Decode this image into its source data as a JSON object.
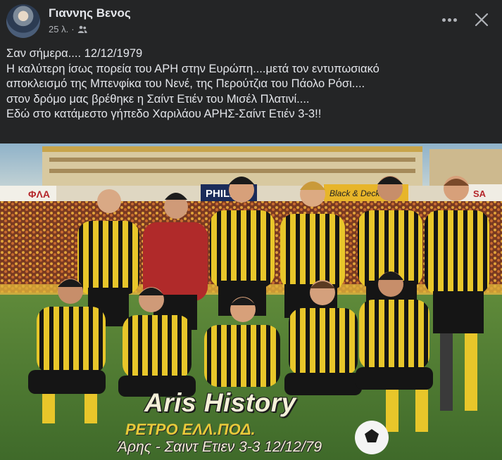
{
  "post": {
    "author": "Γιαννης Βενος",
    "time": "25 λ.",
    "separator": "·",
    "audience_icon": "friends-icon",
    "more_icon": "more-options-icon",
    "close_icon": "close-icon",
    "text_lines": [
      "Σαν σήμερα.... 12/12/1979",
      "Η καλύτερη ίσως πορεία του ΑΡΗ στην Ευρώπη....μετά τον εντυπωσιακό",
      "αποκλεισμό της Μπενφίκα του Νενέ, της Περούτζια του Πάολο Ρόσι....",
      "στον δρόμο μας βρέθηκε η Σαίντ Ετιέν του Μισέλ Πλατινί....",
      "Εδώ στο κατάμεστο γήπεδο Χαριλάου ΑΡΗΣ-Σαίντ Ετιέν 3-3!!"
    ]
  },
  "photo": {
    "stadium_banners": [
      "ΦΛΑ",
      "PHILIPS",
      "Black & Decker",
      "SA"
    ],
    "watermark_title": "Aris History",
    "watermark_subtitle": "ΡΕΤΡΟ ΕΛΛ.ΠΟΔ.",
    "watermark_caption": "Άρης - Σαιντ Ετιεν 3-3  12/12/79"
  },
  "colors": {
    "background": "#242526",
    "text": "#e4e6eb",
    "secondary_text": "#b0b3b8",
    "kit_yellow": "#e8c62a",
    "kit_black": "#151515",
    "goalkeeper_red": "#b02a2a"
  }
}
